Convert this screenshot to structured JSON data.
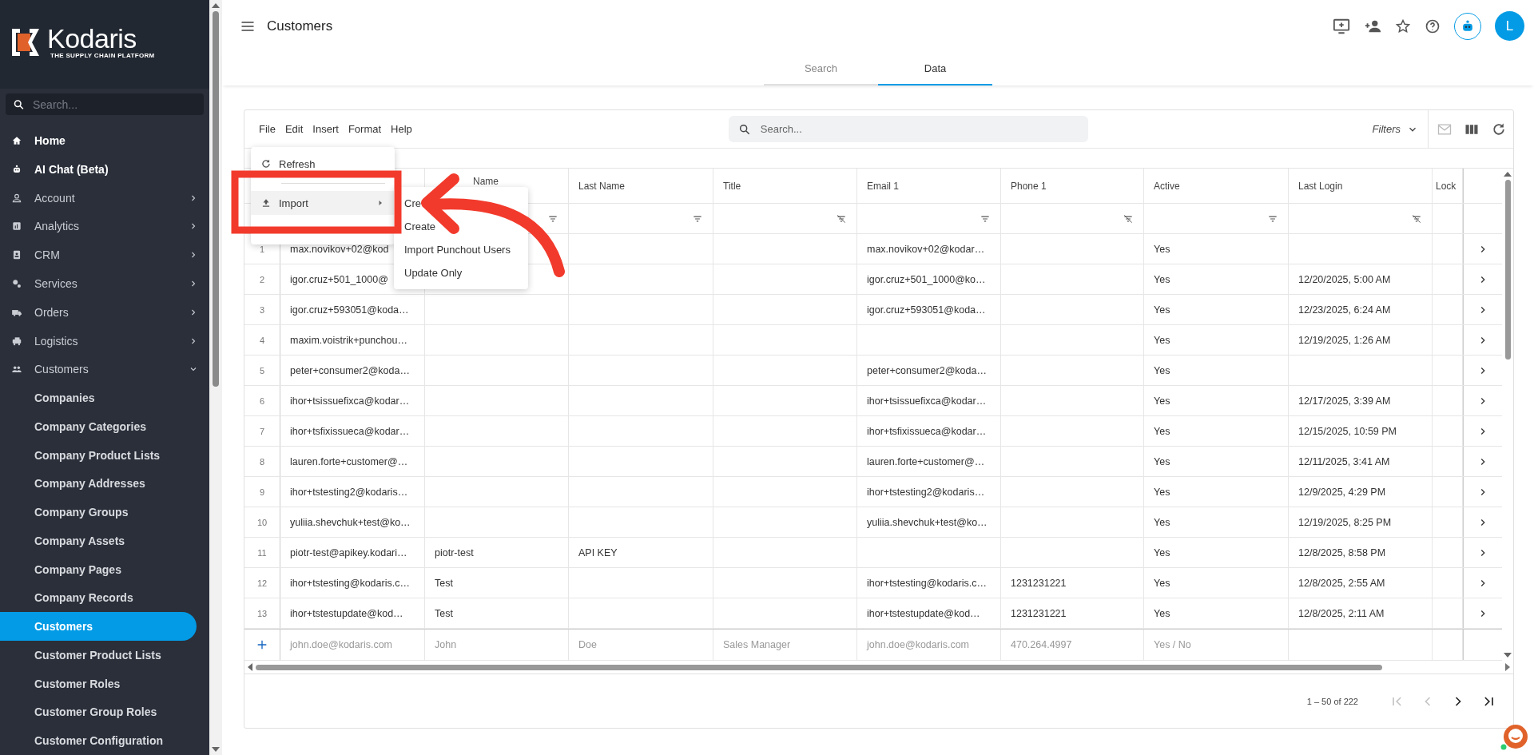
{
  "brand": {
    "name": "Kodaris",
    "tagline": "THE SUPPLY CHAIN PLATFORM"
  },
  "sidebar": {
    "search": {
      "placeholder": "Search..."
    },
    "items": [
      {
        "label": "Home",
        "kind": "link",
        "bold": true
      },
      {
        "label": "AI Chat (Beta)",
        "kind": "link",
        "bold": true
      },
      {
        "label": "Account",
        "kind": "group",
        "expanded": false
      },
      {
        "label": "Analytics",
        "kind": "group",
        "expanded": false
      },
      {
        "label": "CRM",
        "kind": "group",
        "expanded": false
      },
      {
        "label": "Services",
        "kind": "group",
        "expanded": false
      },
      {
        "label": "Orders",
        "kind": "group",
        "expanded": false
      },
      {
        "label": "Logistics",
        "kind": "group",
        "expanded": false
      },
      {
        "label": "Customers",
        "kind": "group",
        "expanded": true,
        "children": [
          {
            "label": "Companies",
            "selected": false
          },
          {
            "label": "Company Categories",
            "selected": false
          },
          {
            "label": "Company Product Lists",
            "selected": false
          },
          {
            "label": "Company Addresses",
            "selected": false
          },
          {
            "label": "Company Groups",
            "selected": false
          },
          {
            "label": "Company Assets",
            "selected": false
          },
          {
            "label": "Company Pages",
            "selected": false
          },
          {
            "label": "Company Records",
            "selected": false
          },
          {
            "label": "Customers",
            "selected": true
          },
          {
            "label": "Customer Product Lists",
            "selected": false
          },
          {
            "label": "Customer Roles",
            "selected": false
          },
          {
            "label": "Customer Group Roles",
            "selected": false
          },
          {
            "label": "Customer Configuration",
            "selected": false
          }
        ]
      }
    ]
  },
  "header": {
    "title": "Customers",
    "avatar": "L"
  },
  "tabs": [
    {
      "label": "Search",
      "selected": false
    },
    {
      "label": "Data",
      "selected": true
    }
  ],
  "menubar": [
    "File",
    "Edit",
    "Insert",
    "Format",
    "Help"
  ],
  "file_menu": {
    "items": [
      {
        "label": "Refresh",
        "highlighted": false
      },
      {
        "label": "Import",
        "highlighted": true
      }
    ]
  },
  "submenu": [
    "Cre",
    "Create",
    "Import Punchout Users",
    "Update Only"
  ],
  "toolbar": {
    "search_placeholder": "Search...",
    "filters": "Filters",
    "actions": [
      {
        "disabled": true
      },
      {
        "disabled": false
      },
      {
        "disabled": false
      }
    ]
  },
  "columns": [
    {
      "label": "Name",
      "filter_active": true
    },
    {
      "label": "Last Name",
      "filter_active": true
    },
    {
      "label": "Title",
      "filter_active": false
    },
    {
      "label": "Email 1",
      "filter_active": true
    },
    {
      "label": "Phone 1",
      "filter_active": false
    },
    {
      "label": "Active",
      "filter_active": true
    },
    {
      "label": "Last Login",
      "filter_active": false
    },
    {
      "label": "Lock"
    }
  ],
  "rows": [
    {
      "number": "1",
      "cells": [
        "max.novikov+02@kod",
        "",
        "",
        "",
        "max.novikov+02@kodar…",
        "",
        "Yes",
        ""
      ]
    },
    {
      "number": "2",
      "cells": [
        "igor.cruz+501_1000@",
        "",
        "",
        "",
        "igor.cruz+501_1000@ko…",
        "",
        "Yes",
        "12/20/2025, 5:00 AM"
      ]
    },
    {
      "number": "3",
      "cells": [
        "igor.cruz+593051@koda…",
        "",
        "",
        "",
        "igor.cruz+593051@koda…",
        "",
        "Yes",
        "12/23/2025, 6:24 AM"
      ]
    },
    {
      "number": "4",
      "cells": [
        "maxim.voistrik+punchou…",
        "",
        "",
        "",
        "",
        "",
        "Yes",
        "12/19/2025, 1:26 AM"
      ]
    },
    {
      "number": "5",
      "cells": [
        "peter+consumer2@koda…",
        "",
        "",
        "",
        "peter+consumer2@koda…",
        "",
        "Yes",
        ""
      ]
    },
    {
      "number": "6",
      "cells": [
        "ihor+tsissuefixca@kodar…",
        "",
        "",
        "",
        "ihor+tsissuefixca@kodar…",
        "",
        "Yes",
        "12/17/2025, 3:39 AM"
      ]
    },
    {
      "number": "7",
      "cells": [
        "ihor+tsfixissueca@kodar…",
        "",
        "",
        "",
        "ihor+tsfixissueca@kodar…",
        "",
        "Yes",
        "12/15/2025, 10:59 PM"
      ]
    },
    {
      "number": "8",
      "cells": [
        "lauren.forte+customer@…",
        "",
        "",
        "",
        "lauren.forte+customer@…",
        "",
        "Yes",
        "12/11/2025, 3:41 AM"
      ]
    },
    {
      "number": "9",
      "cells": [
        "ihor+tstesting2@kodaris…",
        "",
        "",
        "",
        "ihor+tstesting2@kodaris…",
        "",
        "Yes",
        "12/9/2025, 4:29 PM"
      ]
    },
    {
      "number": "10",
      "cells": [
        "yuliia.shevchuk+test@ko…",
        "",
        "",
        "",
        "yuliia.shevchuk+test@ko…",
        "",
        "Yes",
        "12/19/2025, 8:25 PM"
      ]
    },
    {
      "number": "11",
      "cells": [
        "piotr-test@apikey.kodari…",
        "piotr-test",
        "API KEY",
        "",
        "",
        "",
        "Yes",
        "12/8/2025, 8:58 PM"
      ]
    },
    {
      "number": "12",
      "cells": [
        "ihor+tstesting@kodaris.c…",
        "Test",
        "",
        "",
        "ihor+tstesting@kodaris.c…",
        "1231231221",
        "Yes",
        "12/8/2025, 2:55 AM"
      ]
    },
    {
      "number": "13",
      "cells": [
        "ihor+tstestupdate@kod…",
        "Test",
        "",
        "",
        "ihor+tstestupdate@kod…",
        "1231231221",
        "Yes",
        "12/8/2025, 2:11 AM"
      ]
    }
  ],
  "new_row": {
    "placeholders": [
      "john.doe@kodaris.com",
      "John",
      "Doe",
      "Sales Manager",
      "john.doe@kodaris.com",
      "470.264.4997",
      "Yes / No"
    ]
  },
  "pagination": {
    "range": "1 – 50 of 222",
    "buttons": [
      {
        "disabled": true
      },
      {
        "disabled": true
      },
      {
        "disabled": false
      },
      {
        "disabled": false
      }
    ]
  }
}
